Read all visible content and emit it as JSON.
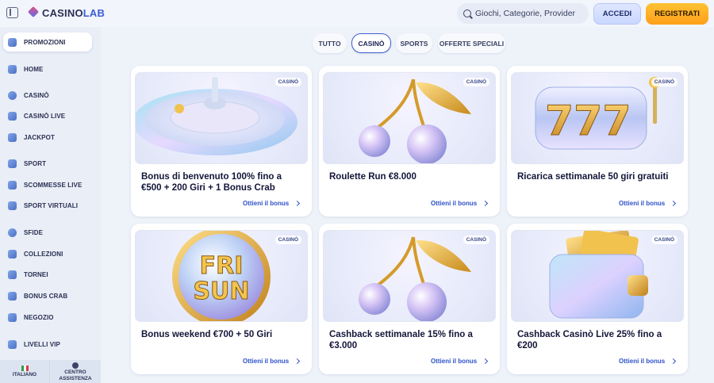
{
  "header": {
    "logo_main": "CASINO",
    "logo_accent": "LAB",
    "search_placeholder": "Giochi, Categorie, Provider",
    "login_label": "ACCEDI",
    "register_label": "REGISTRATI"
  },
  "sidebar": {
    "promo_label": "PROMOZIONI",
    "items": [
      {
        "label": "HOME",
        "icon": "home-icon"
      },
      {
        "label": "CASINÒ",
        "icon": "casino-chip-icon"
      },
      {
        "label": "CASINÒ LIVE",
        "icon": "live-casino-icon"
      },
      {
        "label": "JACKPOT",
        "icon": "jackpot-icon"
      },
      {
        "label": "SPORT",
        "icon": "sport-icon"
      },
      {
        "label": "SCOMMESSE LIVE",
        "icon": "live-bets-icon"
      },
      {
        "label": "SPORT VIRTUALI",
        "icon": "virtual-sport-icon"
      },
      {
        "label": "SFIDE",
        "icon": "challenges-icon"
      },
      {
        "label": "COLLEZIONI",
        "icon": "collections-icon"
      },
      {
        "label": "TORNEI",
        "icon": "trophy-icon"
      },
      {
        "label": "BONUS CRAB",
        "icon": "crab-icon"
      },
      {
        "label": "NEGOZIO",
        "icon": "shop-icon"
      },
      {
        "label": "LIVELLI VIP",
        "icon": "vip-icon"
      }
    ],
    "footer": {
      "language_label": "ITALIANO",
      "help_label_1": "CENTRO",
      "help_label_2": "ASSISTENZA"
    }
  },
  "tabs": [
    {
      "label": "TUTTO",
      "active": false
    },
    {
      "label": "CASINÒ",
      "active": true
    },
    {
      "label": "SPORTS",
      "active": false
    },
    {
      "label": "OFFERTE SPECIALI",
      "active": false
    }
  ],
  "cards": [
    {
      "badge": "CASINÒ",
      "title": "Bonus di benvenuto 100% fino a €500 + 200 Giri + 1 Bonus Crab",
      "cta": "Ottieni il bonus",
      "art": "roulette-wheel"
    },
    {
      "badge": "CASINÒ",
      "title": "Roulette Run €8.000",
      "cta": "Ottieni il bonus",
      "art": "cherries"
    },
    {
      "badge": "CASINÒ",
      "title": "Ricarica settimanale 50 giri gratuiti",
      "cta": "Ottieni il bonus",
      "art": "slot-777"
    },
    {
      "badge": "CASINÒ",
      "title": "Bonus weekend €700 + 50 Giri",
      "cta": "Ottieni il bonus",
      "art": "fri-sun-coin",
      "art_text_1": "FRI",
      "art_text_2": "SUN"
    },
    {
      "badge": "CASINÒ",
      "title": "Cashback settimanale 15% fino a €3.000",
      "cta": "Ottieni il bonus",
      "art": "cherries"
    },
    {
      "badge": "CASINÒ",
      "title": "Cashback Casinò Live 25% fino a €200",
      "cta": "Ottieni il bonus",
      "art": "wallet"
    }
  ],
  "colors": {
    "accent": "#3d5fcf",
    "cta": "#2f52c9",
    "register": "#ffad1f",
    "login": "#d4dfff"
  }
}
